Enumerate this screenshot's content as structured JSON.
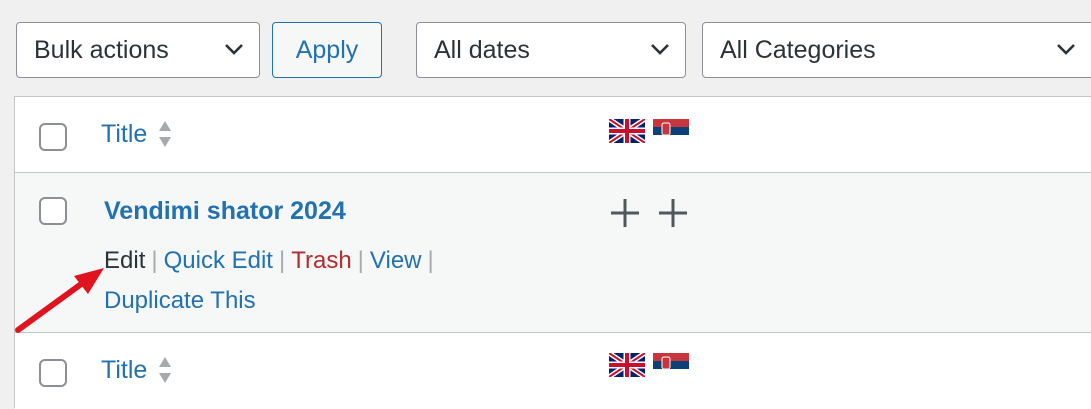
{
  "toolbar": {
    "bulk_actions": "Bulk actions",
    "apply": "Apply",
    "dates": "All dates",
    "categories": "All Categories"
  },
  "table": {
    "header": {
      "title": "Title"
    },
    "footer": {
      "title": "Title"
    },
    "post": {
      "title": "Vendimi shator 2024",
      "actions": {
        "edit": "Edit",
        "quick_edit": "Quick Edit",
        "trash": "Trash",
        "view": "View",
        "duplicate": "Duplicate This"
      }
    },
    "languages": [
      "uk-flag-icon",
      "serbia-flag-icon"
    ]
  },
  "colors": {
    "accent": "#2271b1",
    "trash": "#b32d2e",
    "annotation_arrow": "#e0141e"
  }
}
